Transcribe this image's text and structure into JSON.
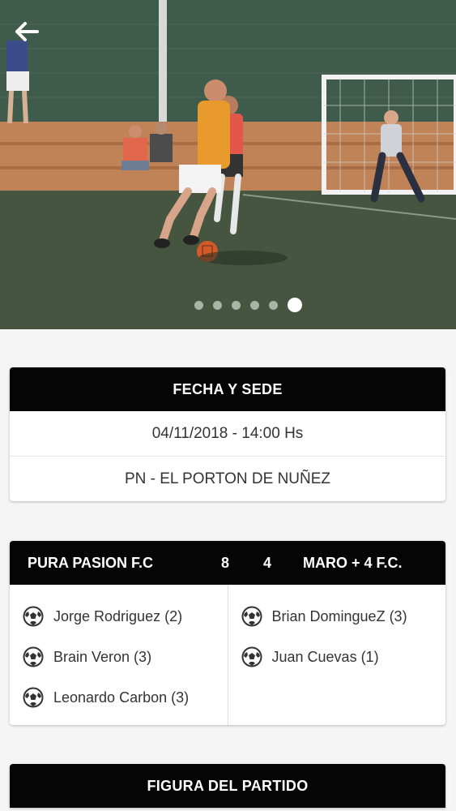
{
  "hero": {
    "carousel": {
      "count": 6,
      "active_index": 5
    }
  },
  "venue_card": {
    "header": "FECHA Y SEDE",
    "datetime": "04/11/2018 - 14:00 Hs",
    "venue": "PN - EL PORTON DE NUÑEZ"
  },
  "match_card": {
    "home_team": "PURA PASION F.C",
    "home_score": "8",
    "away_score": "4",
    "away_team": "MARO + 4 F.C.",
    "home_scorers": [
      {
        "name": "Jorge Rodriguez (2)",
        "icon": "soccer-ball-icon"
      },
      {
        "name": "Brain Veron (3)",
        "icon": "soccer-ball-icon"
      },
      {
        "name": "Leonardo Carbon (3)",
        "icon": "soccer-ball-icon"
      }
    ],
    "away_scorers": [
      {
        "name": "Brian DominguеZ (3)",
        "icon": "soccer-ball-icon"
      },
      {
        "name": "Juan Cuevas (1)",
        "icon": "soccer-ball-icon"
      }
    ]
  },
  "figure_card": {
    "header": "FIGURA DEL PARTIDO"
  },
  "colors": {
    "header_bg": "#050505",
    "card_bg": "#ffffff",
    "page_bg": "#f5f5f5"
  }
}
